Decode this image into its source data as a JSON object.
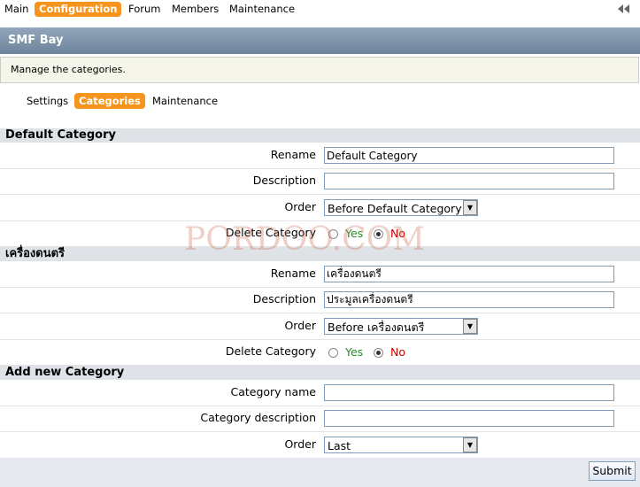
{
  "topnav": {
    "tabs": [
      {
        "label": "Main"
      },
      {
        "label": "Configuration",
        "active": true
      },
      {
        "label": "Forum"
      },
      {
        "label": "Members"
      },
      {
        "label": "Maintenance"
      }
    ],
    "collapse_icon": "double-arrow-left-icon"
  },
  "title": "SMF Bay",
  "info": "Manage the categories.",
  "subnav": {
    "tabs": [
      {
        "label": "Settings"
      },
      {
        "label": "Categories",
        "active": true
      },
      {
        "label": "Maintenance"
      }
    ]
  },
  "sections": [
    {
      "header": "Default Category",
      "rename_label": "Rename",
      "rename_value": "Default Category",
      "description_label": "Description",
      "description_value": "",
      "order_label": "Order",
      "order_value": "Before Default Category",
      "delete_label": "Delete Category",
      "yes_label": "Yes",
      "no_label": "No",
      "selected": "No"
    },
    {
      "header": "เครื่องดนตรี",
      "rename_label": "Rename",
      "rename_value": "เครื่องดนตรี",
      "description_label": "Description",
      "description_value": "ประมูลเครื่องดนตรี",
      "order_label": "Order",
      "order_value": "Before เครื่องดนตรี",
      "delete_label": "Delete Category",
      "yes_label": "Yes",
      "no_label": "No",
      "selected": "No"
    }
  ],
  "add_new": {
    "header": "Add new Category",
    "name_label": "Category name",
    "name_value": "",
    "description_label": "Category description",
    "description_value": "",
    "order_label": "Order",
    "order_value": "Last"
  },
  "submit_label": "Submit",
  "watermark": "PORDOO.COM"
}
